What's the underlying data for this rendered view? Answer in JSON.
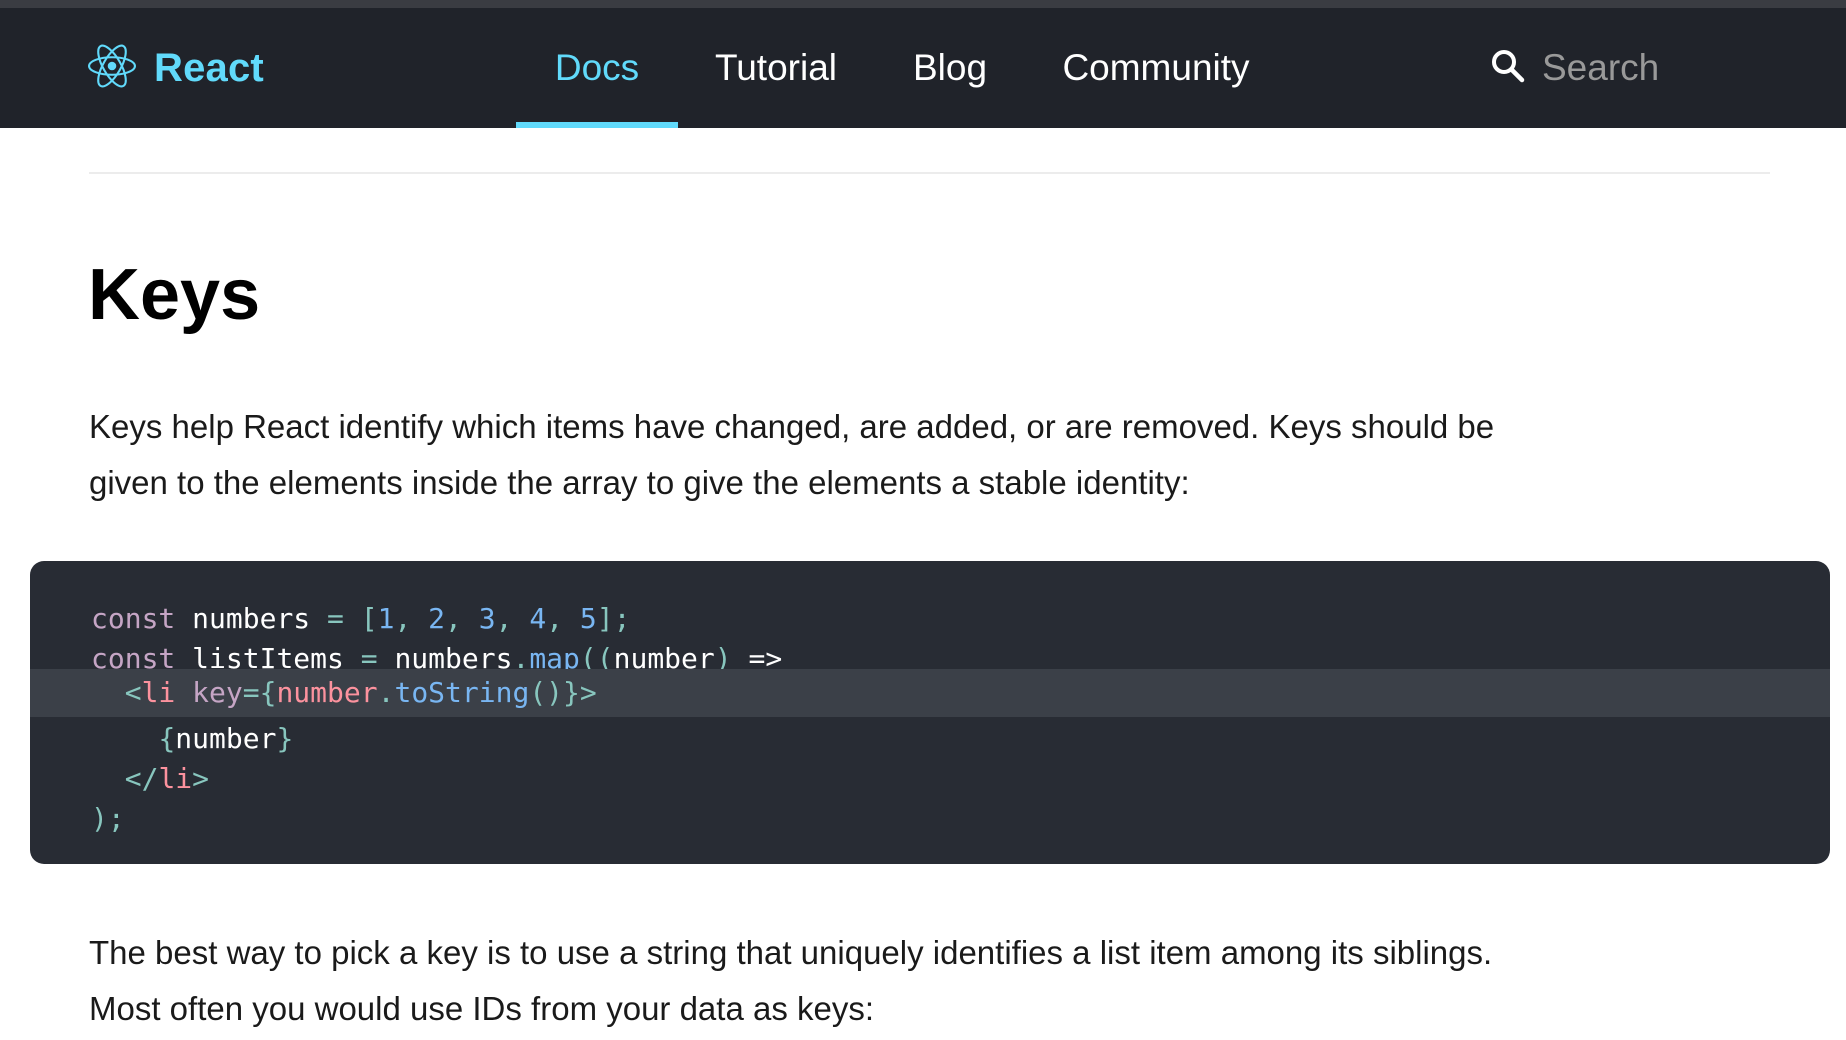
{
  "nav": {
    "brand": "React",
    "items": [
      {
        "label": "Docs",
        "active": true
      },
      {
        "label": "Tutorial",
        "active": false
      },
      {
        "label": "Blog",
        "active": false
      },
      {
        "label": "Community",
        "active": false
      }
    ],
    "search_placeholder": "Search",
    "icons": {
      "logo": "react-atom-icon",
      "search": "search-icon"
    }
  },
  "colors": {
    "navbar_bg": "#20232a",
    "accent": "#61dafb",
    "code_bg": "#282c34",
    "code_highlight": "#3b4048"
  },
  "article": {
    "title": "Keys",
    "para1": "Keys help React identify which items have changed, are added, or are removed. Keys should be given to the elements inside the array to give the elements a stable identity:",
    "para2": "The best way to pick a key is to use a string that uniquely identifies a list item among its siblings. Most often you would use IDs from your data as keys:"
  },
  "code": {
    "lines": [
      {
        "tokens": [
          {
            "t": "const",
            "c": "keyword"
          },
          {
            "t": " numbers ",
            "c": "plain"
          },
          {
            "t": "=",
            "c": "punct"
          },
          {
            "t": " ",
            "c": "plain"
          },
          {
            "t": "[",
            "c": "punct"
          },
          {
            "t": "1",
            "c": "number"
          },
          {
            "t": ", ",
            "c": "punct"
          },
          {
            "t": "2",
            "c": "number"
          },
          {
            "t": ", ",
            "c": "punct"
          },
          {
            "t": "3",
            "c": "number"
          },
          {
            "t": ", ",
            "c": "punct"
          },
          {
            "t": "4",
            "c": "number"
          },
          {
            "t": ", ",
            "c": "punct"
          },
          {
            "t": "5",
            "c": "number"
          },
          {
            "t": "];",
            "c": "punct"
          }
        ]
      },
      {
        "tokens": [
          {
            "t": "const",
            "c": "keyword"
          },
          {
            "t": " listItems ",
            "c": "plain"
          },
          {
            "t": "=",
            "c": "punct"
          },
          {
            "t": " numbers",
            "c": "plain"
          },
          {
            "t": ".",
            "c": "punct"
          },
          {
            "t": "map",
            "c": "func"
          },
          {
            "t": "((",
            "c": "punct"
          },
          {
            "t": "number",
            "c": "plain"
          },
          {
            "t": ")",
            "c": "punct"
          },
          {
            "t": " =>",
            "c": "plain"
          }
        ]
      },
      {
        "highlight": true,
        "tokens": [
          {
            "t": "  ",
            "c": "plain"
          },
          {
            "t": "<",
            "c": "punct"
          },
          {
            "t": "li",
            "c": "tag"
          },
          {
            "t": " key",
            "c": "attr"
          },
          {
            "t": "=",
            "c": "punct"
          },
          {
            "t": "{",
            "c": "punct"
          },
          {
            "t": "number",
            "c": "tag"
          },
          {
            "t": ".",
            "c": "punct"
          },
          {
            "t": "toString",
            "c": "func"
          },
          {
            "t": "()",
            "c": "punct"
          },
          {
            "t": "}",
            "c": "punct"
          },
          {
            "t": ">",
            "c": "punct"
          }
        ]
      },
      {
        "tokens": [
          {
            "t": "    ",
            "c": "plain"
          },
          {
            "t": "{",
            "c": "punct"
          },
          {
            "t": "number",
            "c": "plain"
          },
          {
            "t": "}",
            "c": "punct"
          }
        ]
      },
      {
        "tokens": [
          {
            "t": "  ",
            "c": "plain"
          },
          {
            "t": "</",
            "c": "punct"
          },
          {
            "t": "li",
            "c": "tag"
          },
          {
            "t": ">",
            "c": "punct"
          }
        ]
      },
      {
        "tokens": [
          {
            "t": ");",
            "c": "punct"
          }
        ]
      }
    ]
  }
}
